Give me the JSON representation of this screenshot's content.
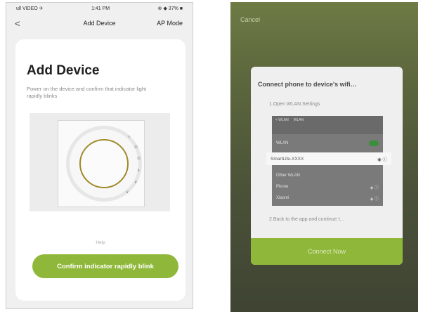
{
  "left": {
    "status": {
      "carrier": "ull VIDEO ✈",
      "time": "1:41 PM",
      "battery": "⊕ ◆ 37% ■"
    },
    "nav": {
      "back_glyph": "<",
      "title": "Add Device",
      "right": "AP Mode"
    },
    "card": {
      "title": "Add Device",
      "description": "Power on the device and confirm that indicator light rapidly blinks",
      "help": "Help",
      "confirm_label": "Confirm indicator rapidly blink"
    },
    "device": {
      "marks": [
        "☼",
        "⊙",
        "⊙",
        "∧",
        "∨",
        "∨"
      ]
    }
  },
  "right": {
    "cancel": "Cancel",
    "dialog": {
      "title": "Connect phone to device's wifi…",
      "step1": "1.Open WLAN Settings",
      "step2": "2.Back to the app and continue t…",
      "connect_label": "Connect Now"
    },
    "wifi": {
      "header_left": "< WLAN",
      "header_mid": "WLAN",
      "row1": "WLAN",
      "network": "SmartLife-XXXX",
      "row2": "Other WLAN",
      "row3": "Phone",
      "row4": "Xiaomi"
    }
  },
  "colors": {
    "accent": "#8fb83a",
    "dial_ring": "#a08a2a"
  }
}
